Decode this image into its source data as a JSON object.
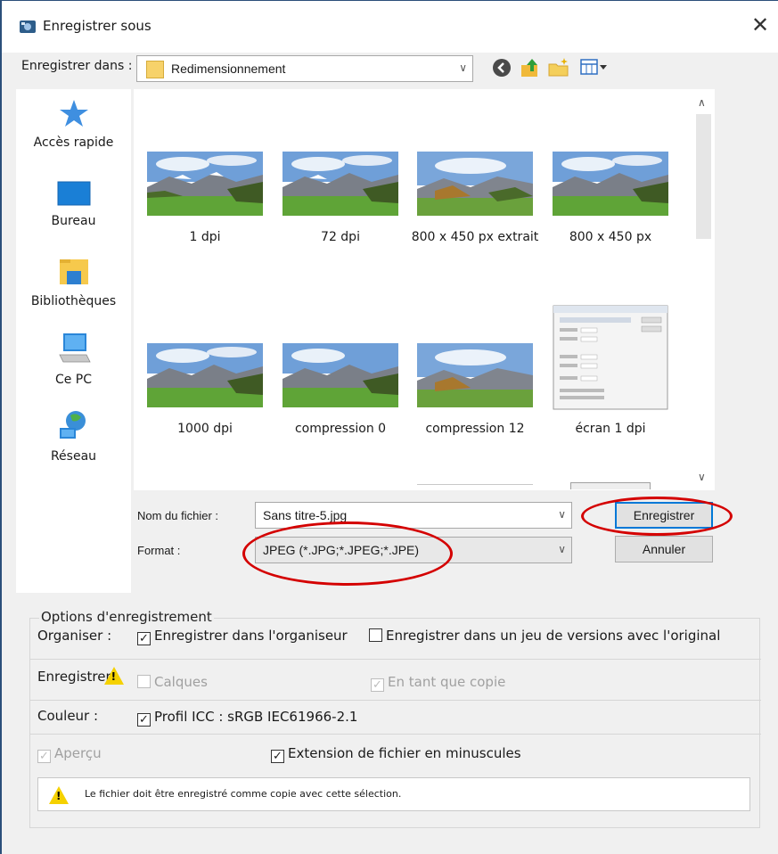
{
  "window": {
    "title": "Enregistrer sous",
    "close_glyph": "✕"
  },
  "save_in": {
    "label": "Enregistrer dans :",
    "value": "Redimensionnement"
  },
  "nav_icons": [
    "back-icon",
    "up-folder-icon",
    "new-folder-icon",
    "view-menu-icon"
  ],
  "sidebar": {
    "items": [
      {
        "label": "Accès rapide",
        "icon": "star-icon"
      },
      {
        "label": "Bureau",
        "icon": "desktop-icon"
      },
      {
        "label": "Bibliothèques",
        "icon": "libraries-icon"
      },
      {
        "label": "Ce PC",
        "icon": "computer-icon"
      },
      {
        "label": "Réseau",
        "icon": "network-icon"
      }
    ]
  },
  "files": [
    {
      "name": "1 dpi"
    },
    {
      "name": "72 dpi"
    },
    {
      "name": "800 x 450 px extrait"
    },
    {
      "name": "800 x 450 px"
    },
    {
      "name": "1000 dpi"
    },
    {
      "name": "compression 0"
    },
    {
      "name": "compression 12"
    },
    {
      "name": "écran 1 dpi"
    }
  ],
  "filename": {
    "label": "Nom du fichier :",
    "value": "Sans titre-5.jpg"
  },
  "format": {
    "label": "Format :",
    "value": "JPEG (*.JPG;*.JPEG;*.JPE)"
  },
  "buttons": {
    "save": "Enregistrer",
    "cancel": "Annuler"
  },
  "options": {
    "legend": "Options d'enregistrement",
    "organiser_label": "Organiser :",
    "organiser_checkbox": "Enregistrer dans l'organiseur",
    "versions_checkbox": "Enregistrer dans un jeu de versions avec l'original",
    "enregistrer_label": "Enregistrer",
    "calques": "Calques",
    "copie": "En tant que copie",
    "couleur_label": "Couleur :",
    "icc": "Profil ICC : sRGB IEC61966-2.1",
    "apercu": "Aperçu",
    "extension": "Extension de fichier en minuscules",
    "warning": "Le fichier doit être enregistré comme copie avec cette sélection."
  },
  "colors": {
    "accent": "#0078d7",
    "highlight": "#d40000",
    "warning": "#f5d100"
  }
}
